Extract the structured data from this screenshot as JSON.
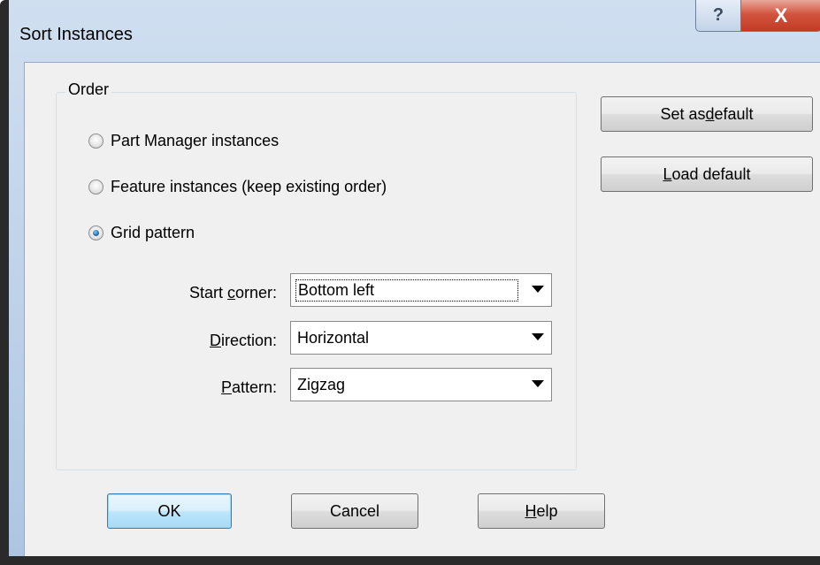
{
  "window": {
    "title": "Sort Instances",
    "help_glyph": "?",
    "close_glyph": "X"
  },
  "order_group": {
    "label": "Order",
    "options": [
      {
        "label": "Part Manager instances",
        "checked": false
      },
      {
        "label": "Feature instances (keep existing order)",
        "checked": false
      },
      {
        "label": "Grid pattern",
        "checked": true
      }
    ]
  },
  "fields": {
    "start_corner": {
      "label_pre": "Start ",
      "label_key": "c",
      "label_post": "orner:",
      "value": "Bottom left"
    },
    "direction": {
      "label_pre": "",
      "label_key": "D",
      "label_post": "irection:",
      "value": "Horizontal"
    },
    "pattern": {
      "label_pre": "",
      "label_key": "P",
      "label_post": "attern:",
      "value": "Zigzag"
    }
  },
  "side_buttons": {
    "set_default": {
      "pre": "Set as ",
      "key": "d",
      "post": "efault"
    },
    "load_default": {
      "pre": "",
      "key": "L",
      "post": "oad default"
    }
  },
  "footer_buttons": {
    "ok": "OK",
    "cancel": "Cancel",
    "help": {
      "pre": "",
      "key": "H",
      "post": "elp"
    }
  }
}
